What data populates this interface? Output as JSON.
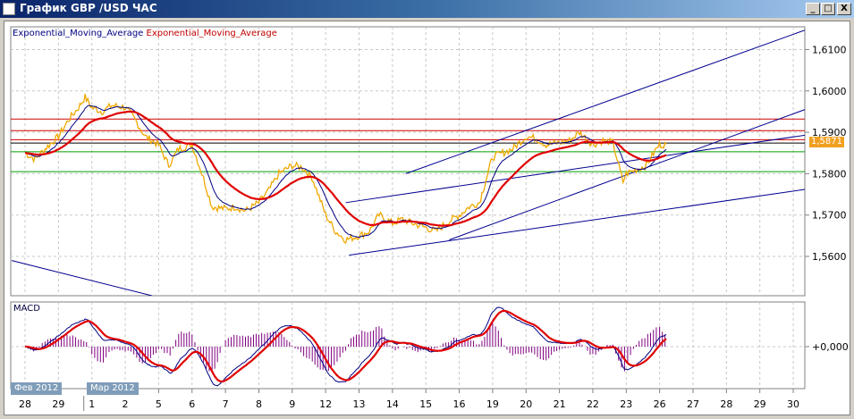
{
  "window": {
    "title": "График GBP /USD  ЧАС",
    "minimize": "_",
    "maximize": "□",
    "close": "X"
  },
  "legend": {
    "fast_ema": "Exponential_Moving_Average",
    "slow_ema": "Exponential_Moving_Average"
  },
  "macd_label": "MACD",
  "months": [
    "Фев 2012",
    "Мар 2012"
  ],
  "current_price": "1,5871",
  "colors": {
    "price": "#f0a800",
    "fast_ema": "#000080",
    "slow_ema": "#e00000",
    "hist": "#800080",
    "support": "#00a000",
    "resistance": "#d00000"
  },
  "chart_data": {
    "type": "line",
    "title": "График GBP /USD  ЧАС",
    "x_tick_labels": [
      "28",
      "29",
      "1",
      "2",
      "5",
      "6",
      "7",
      "8",
      "9",
      "12",
      "13",
      "14",
      "15",
      "16",
      "19",
      "20",
      "21",
      "22",
      "23",
      "26",
      "27",
      "28",
      "29",
      "30"
    ],
    "y_tick_labels": [
      "1,6100",
      "1,6000",
      "1,5900",
      "1,5800",
      "1,5700",
      "1,5600"
    ],
    "y_ticks": [
      1.61,
      1.6,
      1.59,
      1.58,
      1.57,
      1.56
    ],
    "ylim": [
      1.5505,
      1.6155
    ],
    "macd_tick_label": "+0,000",
    "grid": true,
    "price_series": {
      "x": [
        0,
        0.3,
        0.6,
        1,
        1.3,
        1.6,
        1.8,
        2,
        2.3,
        2.6,
        3,
        3.3,
        3.6,
        4,
        4.3,
        4.6,
        5,
        5.3,
        5.6,
        6,
        6.3,
        6.6,
        7,
        7.3,
        7.6,
        8,
        8.3,
        8.6,
        9,
        9.3,
        9.6,
        10,
        10.3,
        10.6,
        11,
        11.3,
        11.6,
        12,
        12.3,
        12.6,
        13,
        13.3,
        13.6,
        14,
        14.3,
        14.6,
        15,
        15.3,
        15.6,
        16,
        16.3,
        16.6,
        17,
        17.3,
        17.6,
        17.9,
        18,
        18.3,
        18.6,
        18.9,
        19,
        19.2
      ],
      "y": [
        1.585,
        1.5835,
        1.586,
        1.589,
        1.593,
        1.596,
        1.5985,
        1.596,
        1.595,
        1.5965,
        1.596,
        1.593,
        1.589,
        1.587,
        1.582,
        1.586,
        1.587,
        1.58,
        1.572,
        1.5715,
        1.572,
        1.571,
        1.573,
        1.576,
        1.58,
        1.582,
        1.5815,
        1.579,
        1.57,
        1.566,
        1.564,
        1.565,
        1.566,
        1.57,
        1.568,
        1.569,
        1.568,
        1.567,
        1.566,
        1.568,
        1.57,
        1.572,
        1.573,
        1.584,
        1.585,
        1.586,
        1.589,
        1.5885,
        1.587,
        1.5875,
        1.588,
        1.59,
        1.587,
        1.588,
        1.5875,
        1.578,
        1.58,
        1.581,
        1.582,
        1.586,
        1.587,
        1.5871
      ]
    },
    "horizontal_levels": [
      {
        "price": 1.5932,
        "color": "#d00000"
      },
      {
        "price": 1.5904,
        "color": "#d00000"
      },
      {
        "price": 1.5882,
        "color": "#d00000"
      },
      {
        "price": 1.5874,
        "color": "#000000"
      },
      {
        "price": 1.5853,
        "color": "#00a000"
      },
      {
        "price": 1.5805,
        "color": "#00a000"
      }
    ],
    "trend_lines": [
      {
        "from": [
          -0.4,
          1.559
        ],
        "to": [
          3.8,
          1.5505
        ]
      },
      {
        "from": [
          11.4,
          1.58
        ],
        "to": [
          23.35,
          1.6147
        ]
      },
      {
        "from": [
          9.6,
          1.573
        ],
        "to": [
          23.35,
          1.5893
        ]
      },
      {
        "from": [
          9.7,
          1.5603
        ],
        "to": [
          23.35,
          1.5762
        ]
      },
      {
        "from": [
          12.7,
          1.564
        ],
        "to": [
          23.35,
          1.5955
        ]
      }
    ]
  }
}
